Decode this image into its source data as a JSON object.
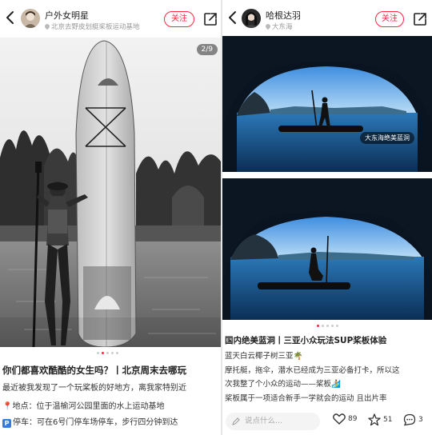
{
  "left": {
    "header": {
      "username": "户外女明星",
      "location": "北京去野皮划艇桨板运动基地",
      "follow_label": "关注"
    },
    "counter": "2/9",
    "title": "你们都喜欢酷酷的女生吗？丨北京周末去哪玩",
    "lines": [
      "最近被我发现了一个玩桨板的好地方，离我家特别近",
      "地点：位于温榆河公园里面的水上运动基地",
      "停车：可在6号门停车场停车，步行四分钟到达"
    ],
    "pin_icon": "📍",
    "parking_badge": "P"
  },
  "right": {
    "header": {
      "username": "哈根达羽",
      "location": "大东海",
      "follow_label": "关注"
    },
    "photo_tag": "大东海绝美蓝洞",
    "title": "国内绝美蓝洞丨三亚小众玩法SUP桨板体验",
    "lines": [
      "蓝天白云椰子树三亚🌴",
      "摩托艇，拖伞，潜水已经成为三亚必备打卡，所以这",
      "次我整了个小众的运动——桨板🏄",
      "桨板属于一项适合新手一学就会的运动 且出片率"
    ],
    "bottom": {
      "comment_placeholder": "说点什么...",
      "likes": "89",
      "stars": "51",
      "comments": "3"
    }
  },
  "colors": {
    "accent": "#ff2442",
    "parking_blue": "#2f7de1",
    "sea_blue": "#1f5f9a"
  }
}
